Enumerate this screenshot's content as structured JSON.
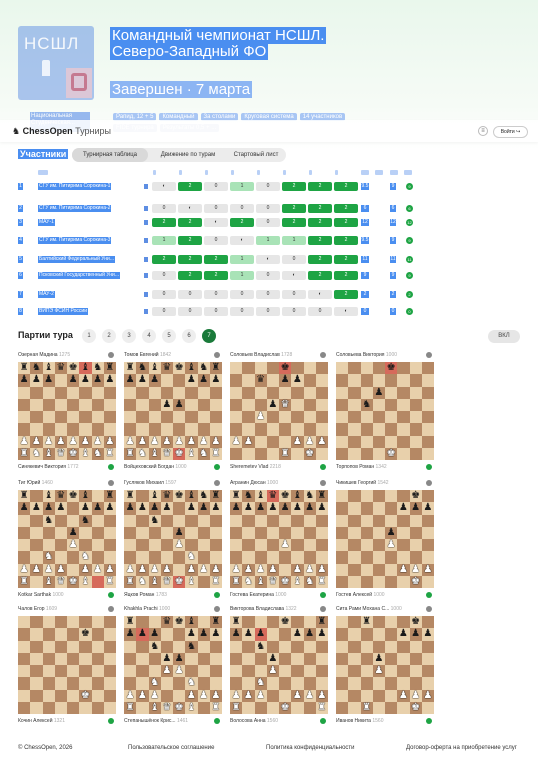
{
  "org": {
    "logo_text": "НСШЛ",
    "name": "Национальная Студенческая..."
  },
  "header": {
    "title_line1": "Командный чемпионат НСШЛ.",
    "title_line2": "Северо-Западный ФО",
    "status": "Завершен · 7 марта",
    "chips": [
      "Рапид, 12 + 5",
      "Командный",
      "За столами",
      "Круговая система",
      "14 участников",
      "FIDE турнира",
      "Результаты 0,5 + ..."
    ]
  },
  "nav": {
    "brand": "ChessOpen",
    "section": "Турниры",
    "menu_icon": "menu-icon",
    "login": "Войти"
  },
  "participants": {
    "title": "Участники",
    "tabs": [
      {
        "label": "Турнирная таблица",
        "active": true
      },
      {
        "label": "Движение по турам",
        "active": false
      },
      {
        "label": "Стартовый лист",
        "active": false
      }
    ],
    "rows": [
      {
        "rank": "1",
        "team": "СГУ им. Питирима Сорокина-1",
        "cells": [
          "x",
          "2",
          "0",
          "1",
          "0",
          "2",
          "2",
          "2"
        ],
        "kinds": [
          "x",
          "w",
          "l",
          "d",
          "l",
          "w",
          "w",
          "w"
        ],
        "score": "9.5",
        "pts": "9",
        "round": "9"
      },
      {
        "rank": "2",
        "team": "СГУ им. Питирима Сорокина-2",
        "cells": [
          "0",
          "x",
          "0",
          "0",
          "0",
          "2",
          "2",
          "2"
        ],
        "kinds": [
          "l",
          "x",
          "l",
          "l",
          "l",
          "w",
          "w",
          "w"
        ],
        "score": "6",
        "pts": "6",
        "round": "6"
      },
      {
        "rank": "3",
        "team": "МАУ-1",
        "cells": [
          "2",
          "2",
          "x",
          "2",
          "0",
          "2",
          "2",
          "2"
        ],
        "kinds": [
          "w",
          "w",
          "x",
          "w",
          "l",
          "w",
          "w",
          "w"
        ],
        "score": "12",
        "pts": "12",
        "round": "12"
      },
      {
        "rank": "4",
        "team": "СГУ им. Питирима Сорокина-3",
        "cells": [
          "1",
          "2",
          "0",
          "x",
          "1",
          "1",
          "2",
          "2"
        ],
        "kinds": [
          "d",
          "w",
          "l",
          "x",
          "d",
          "d",
          "w",
          "w"
        ],
        "score": "9.5",
        "pts": "9",
        "round": "9"
      },
      {
        "rank": "5",
        "team": "Балтийский Федеральный Уни...",
        "cells": [
          "2",
          "2",
          "2",
          "1",
          "x",
          "0",
          "2",
          "2"
        ],
        "kinds": [
          "w",
          "w",
          "w",
          "d",
          "x",
          "l",
          "w",
          "w"
        ],
        "score": "11",
        "pts": "11",
        "round": "11"
      },
      {
        "rank": "6",
        "team": "Псковский Государственный Уни...",
        "cells": [
          "0",
          "2",
          "2",
          "1",
          "0",
          "x",
          "2",
          "2"
        ],
        "kinds": [
          "l",
          "w",
          "w",
          "d",
          "l",
          "x",
          "w",
          "w"
        ],
        "score": "9",
        "pts": "9",
        "round": "9"
      },
      {
        "rank": "7",
        "team": "МАУ-2",
        "cells": [
          "0",
          "0",
          "0",
          "0",
          "0",
          "0",
          "x",
          "2"
        ],
        "kinds": [
          "l",
          "l",
          "l",
          "l",
          "l",
          "l",
          "x",
          "w"
        ],
        "score": "2",
        "pts": "2",
        "round": "2"
      },
      {
        "rank": "8",
        "team": "ВИПЭ ФСИН России",
        "cells": [
          "0",
          "0",
          "0",
          "0",
          "0",
          "0",
          "0",
          "x"
        ],
        "kinds": [
          "l",
          "l",
          "l",
          "l",
          "l",
          "l",
          "l",
          "x"
        ],
        "score": "0",
        "pts": "0",
        "round": "0"
      }
    ]
  },
  "games": {
    "title": "Партии тура",
    "rounds": [
      "1",
      "2",
      "3",
      "4",
      "5",
      "6",
      "7"
    ],
    "active_round": "7",
    "toggle": "ВКЛ",
    "boards": [
      {
        "top": "Озерная Мадина",
        "top_r": "1275",
        "bottom": "Синякевич Виктория",
        "bottom_r": "1772",
        "fen": "rnbqkbnr/ppp1pppp/8/8/8/8/PPPPPPPP/RNBQKBNR",
        "hl": [
          5
        ]
      },
      {
        "top": "Томов Евгений",
        "top_r": "1842",
        "bottom": "Войцеховский Богдан",
        "bottom_r": "1000",
        "fen": "rnbqkbnr/ppp2ppp/8/3pp3/8/8/PPPPPPPP/RNBQKBNR",
        "hl": [
          60
        ]
      },
      {
        "top": "Соловьев Владислав",
        "top_r": "1728",
        "bottom": "Sheremetev Vlad",
        "bottom_r": "2218",
        "fen": "4k3/2q1pp2/8/3pQ3/2P5/8/PP3PPP/4R1K1",
        "hl": [
          4
        ]
      },
      {
        "top": "Соловьева Виктория",
        "top_r": "1000",
        "bottom": "Торпопов Роман",
        "bottom_r": "1342",
        "fen": "4k3/8/3p4/2n5/8/8/8/4K3",
        "hl": [
          4
        ]
      },
      {
        "top": "Тиг Юрий",
        "top_r": "1460",
        "bottom": "Kotkar Sarthak",
        "bottom_r": "1000",
        "fen": "r1bqkb1r/pppp1ppp/2n2n2/4p3/4P3/2N2N2/PPPP1PPP/R1BQKB1R",
        "hl": [
          62
        ]
      },
      {
        "top": "Гусляков Михаил",
        "top_r": "1597",
        "bottom": "Яцков Роман",
        "bottom_r": "1783",
        "fen": "r1bqkbnr/pppp1ppp/2n5/4p3/4P3/5N2/PPPP1PPP/RNBQKB1R",
        "hl": [
          60
        ]
      },
      {
        "top": "Агранин Дюсан",
        "top_r": "1000",
        "bottom": "Гостева Екатерина",
        "bottom_r": "1000",
        "fen": "rnbqkbnr/pppppppp/8/8/4P3/8/PPPP1PPP/RNBQKBNR",
        "hl": [
          3
        ]
      },
      {
        "top": "Чикишев Георгий",
        "top_r": "1542",
        "bottom": "Гостев Алексей",
        "bottom_r": "1000",
        "fen": "6k1/5ppp/8/4p3/4P3/8/5PPP/6K1",
        "hl": []
      },
      {
        "top": "Чалов Егор",
        "top_r": "1609",
        "bottom": "Кочин Алексей",
        "bottom_r": "1321",
        "fen": "8/5k2/8/8/8/8/5K2/8",
        "hl": []
      },
      {
        "top": "Khakhla Prachi",
        "top_r": "1000",
        "bottom": "Степанышёнок Крис...",
        "bottom_r": "1461",
        "fen": "r2qkb1r/ppp2ppp/2n2n2/3pp3/3PP3/2N2N2/PPP2PPP/R1BQKB1R",
        "hl": [
          9
        ]
      },
      {
        "top": "Викторова Владислава",
        "top_r": "1322",
        "bottom": "Волосова Анна",
        "bottom_r": "1560",
        "fen": "r3k2r/ppp2ppp/2n5/3p4/3P4/2N5/PPP2PPP/R3K2R",
        "hl": [
          10
        ]
      },
      {
        "top": "Сита Рами Мохана С...",
        "top_r": "1000",
        "bottom": "Иванов Никита",
        "bottom_r": "1560",
        "fen": "2r3k1/5ppp/8/3p4/3P4/8/5PPP/2R3K1",
        "hl": []
      }
    ]
  },
  "footer": {
    "copyright": "© ChessOpen, 2026",
    "terms": "Пользовательское соглашение",
    "privacy": "Политика конфиденциальности",
    "offer": "Договор-оферта на приобретение услуг"
  }
}
